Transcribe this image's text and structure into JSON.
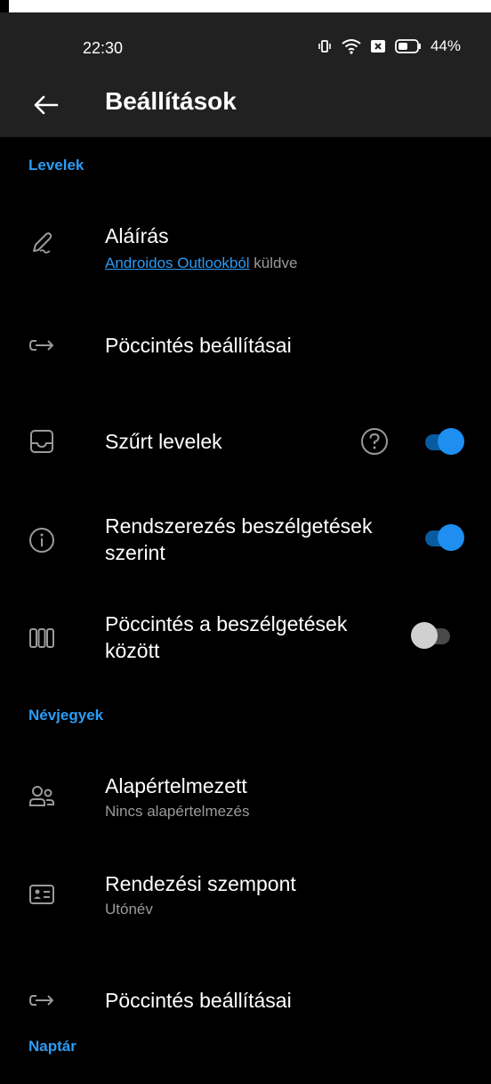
{
  "status": {
    "time": "22:30",
    "battery": "44%"
  },
  "header": {
    "title": "Beállítások"
  },
  "sections": {
    "mail": {
      "title": "Levelek",
      "signature": {
        "label": "Aláírás",
        "link": "Androidos Outlookból",
        "suffix": " küldve"
      },
      "swipe": {
        "label": "Pöccintés beállításai"
      },
      "focused": {
        "label": "Szűrt levelek",
        "on": true
      },
      "threads": {
        "label_line1": "Rendszerezés beszélgetések",
        "label_line2": "szerint",
        "on": true
      },
      "swipe_conv": {
        "label_line1": "Pöccintés a beszélgetések",
        "label_line2": "között",
        "on": false
      }
    },
    "contacts": {
      "title": "Névjegyek",
      "default": {
        "label": "Alapértelmezett",
        "sub": "Nincs alapértelmezés"
      },
      "sort": {
        "label": "Rendezési szempont",
        "sub": "Utónév"
      },
      "swipe": {
        "label": "Pöccintés beállításai"
      }
    },
    "calendar": {
      "title": "Naptár"
    }
  }
}
